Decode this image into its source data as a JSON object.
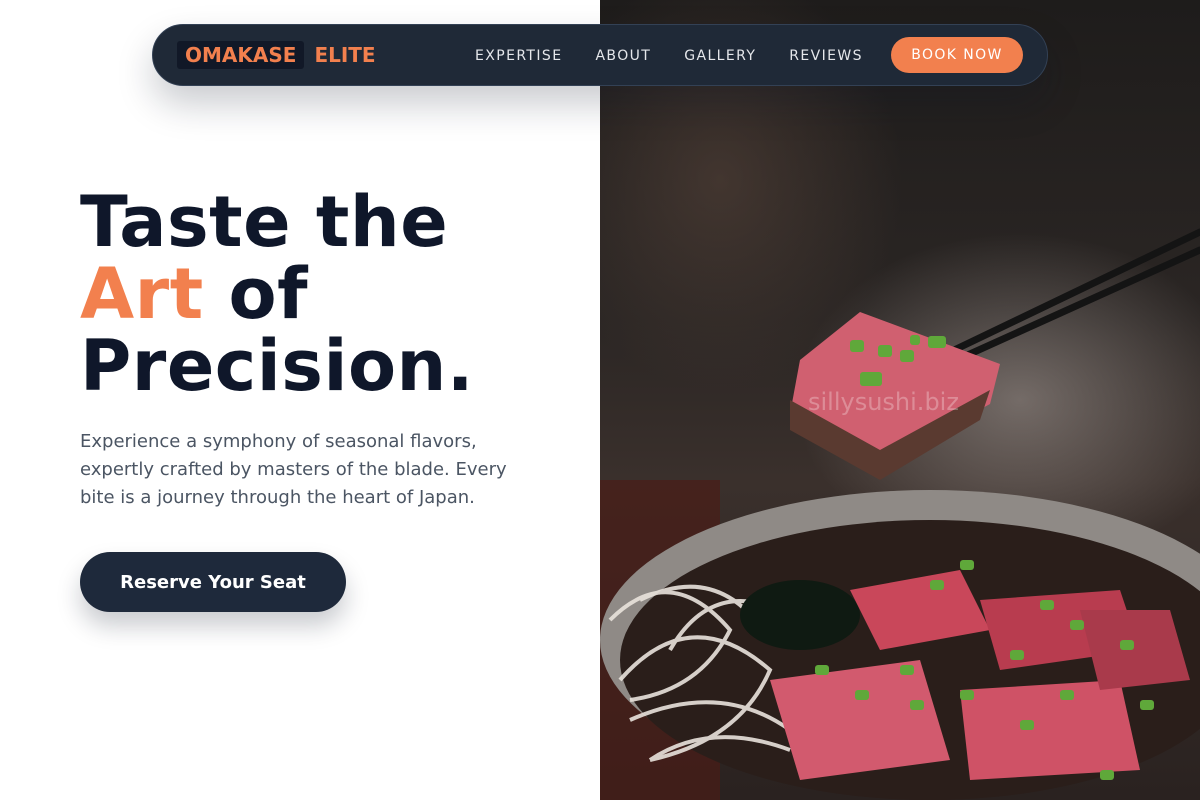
{
  "nav": {
    "brand_primary": "OMAKASE",
    "brand_secondary": "ELITE",
    "links": [
      {
        "label": "EXPERTISE"
      },
      {
        "label": "ABOUT"
      },
      {
        "label": "GALLERY"
      },
      {
        "label": "REVIEWS"
      }
    ],
    "cta_label": "BOOK NOW"
  },
  "hero": {
    "title_line1": "Taste the",
    "title_accent": "Art",
    "title_line2_rest": "of",
    "title_line3": "Precision.",
    "description": "Experience a symphony of seasonal flavors, expertly crafted by masters of the blade. Every bite is a journey through the heart of Japan.",
    "cta_label": "Reserve Your Seat"
  },
  "image": {
    "watermark": "sillysushi.biz"
  },
  "colors": {
    "accent": "#f2804e",
    "dark": "#1e293b",
    "heading": "#0f172a",
    "body_text": "#4b5563"
  }
}
